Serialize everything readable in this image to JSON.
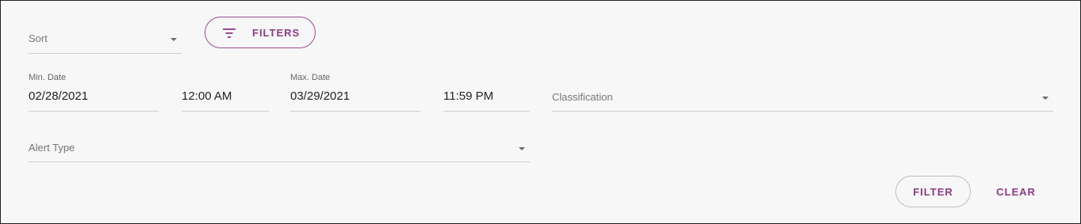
{
  "sort": {
    "placeholder": "Sort"
  },
  "filters_button": {
    "label": "FILTERS",
    "icon": "filter-list-icon"
  },
  "min_date": {
    "label": "Min. Date",
    "date": "02/28/2021",
    "time": "12:00 AM"
  },
  "max_date": {
    "label": "Max. Date",
    "date": "03/29/2021",
    "time": "11:59 PM"
  },
  "classification": {
    "placeholder": "Classification"
  },
  "alert_type": {
    "placeholder": "Alert Type"
  },
  "actions": {
    "filter_label": "FILTER",
    "clear_label": "CLEAR"
  },
  "colors": {
    "accent": "#8e3a87",
    "background": "#f7f7f7",
    "border": "#222222"
  }
}
